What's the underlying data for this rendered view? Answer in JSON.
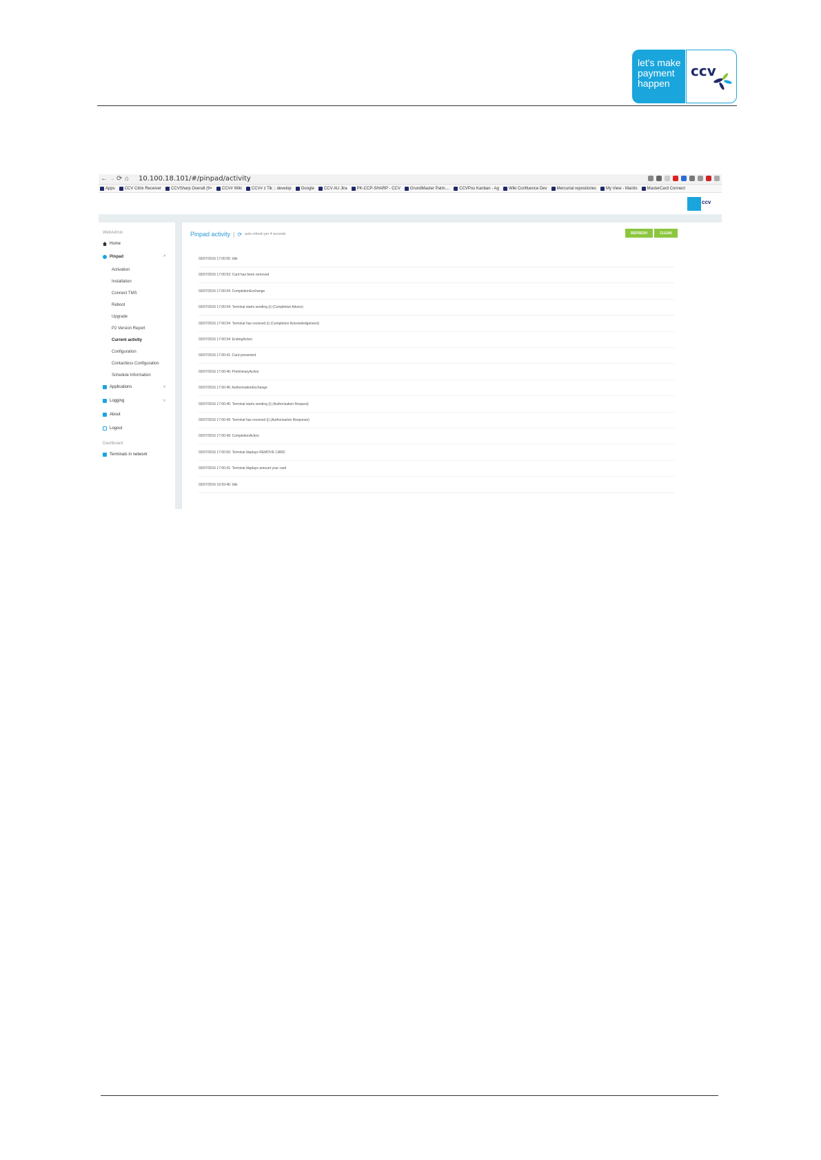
{
  "doc": {
    "logo_line1": "let's make",
    "logo_line2": "payment",
    "logo_line3": "happen",
    "logo_brand": "ccv"
  },
  "browser": {
    "url": "10.100.18.101/#/pinpad/activity",
    "bookmarks": [
      "Apps",
      "CCV Citrix Receiver",
      "CCVSharp Overall (9×",
      "CCV# Wiki",
      "CCV# z Tik :: develop",
      "Google",
      "CCV AU Jira",
      "PK-CCP-SHARP - CCV",
      "GrundMaster Patm....",
      "CCVPos Kanban - Ag",
      "Wiki Confluence Dev",
      "Mercurial repositories",
      "My View - Mantis",
      "MasterCard Connect"
    ]
  },
  "app": {
    "mini_logo": "ccv",
    "sidebar": {
      "section1": "WebAdmin",
      "home": "Home",
      "pinpad": "Pinpad",
      "sub_items": [
        "Activation",
        "Installation",
        "Connect TMS",
        "Reboot",
        "Upgrade",
        "P2 Version Report",
        "Current activity",
        "Configuration",
        "Contactless Configuration",
        "Schedule Information"
      ],
      "applications": "Applications",
      "logging": "Logging",
      "about": "About",
      "logout": "Logout",
      "section2": "Dashboard",
      "terminals": "Terminals in network"
    },
    "main": {
      "title": "Pinpad activity",
      "subtitle": "auto refresh per 4 seconds",
      "refresh_label": "REFRESH",
      "clean_label": "CLEAN",
      "activity": [
        "03/07/2016 17:00:55: Idle",
        "03/07/2016 17:00:53: Card has been removed",
        "03/07/2016 17:00:54: CompletionExchange",
        "03/07/2016 17:00:54: Terminal starts sending (i) (Completion Advice)",
        "03/07/2016 17:00:54: Terminal has received (i) (Completion Acknowledgement)",
        "03/07/2016 17:00:54: EndingAction",
        "03/07/2016 17:00:41: Card presented",
        "03/07/2016 17:00:46: PreliminaryAction",
        "03/07/2016 17:00:46: AuthorisationExchange",
        "03/07/2016 17:00:46: Terminal starts sending (i) (Authorisation Request)",
        "03/07/2016 17:00:49: Terminal has received (i) (Authorisation Response)",
        "03/07/2016 17:00:49: CompletionAction",
        "03/07/2016 17:00:50: Terminal displays REMOVE CARD",
        "03/07/2016 17:00:41: Terminal displays amount your card",
        "03/07/2016 16:59:46: Idle"
      ]
    }
  }
}
